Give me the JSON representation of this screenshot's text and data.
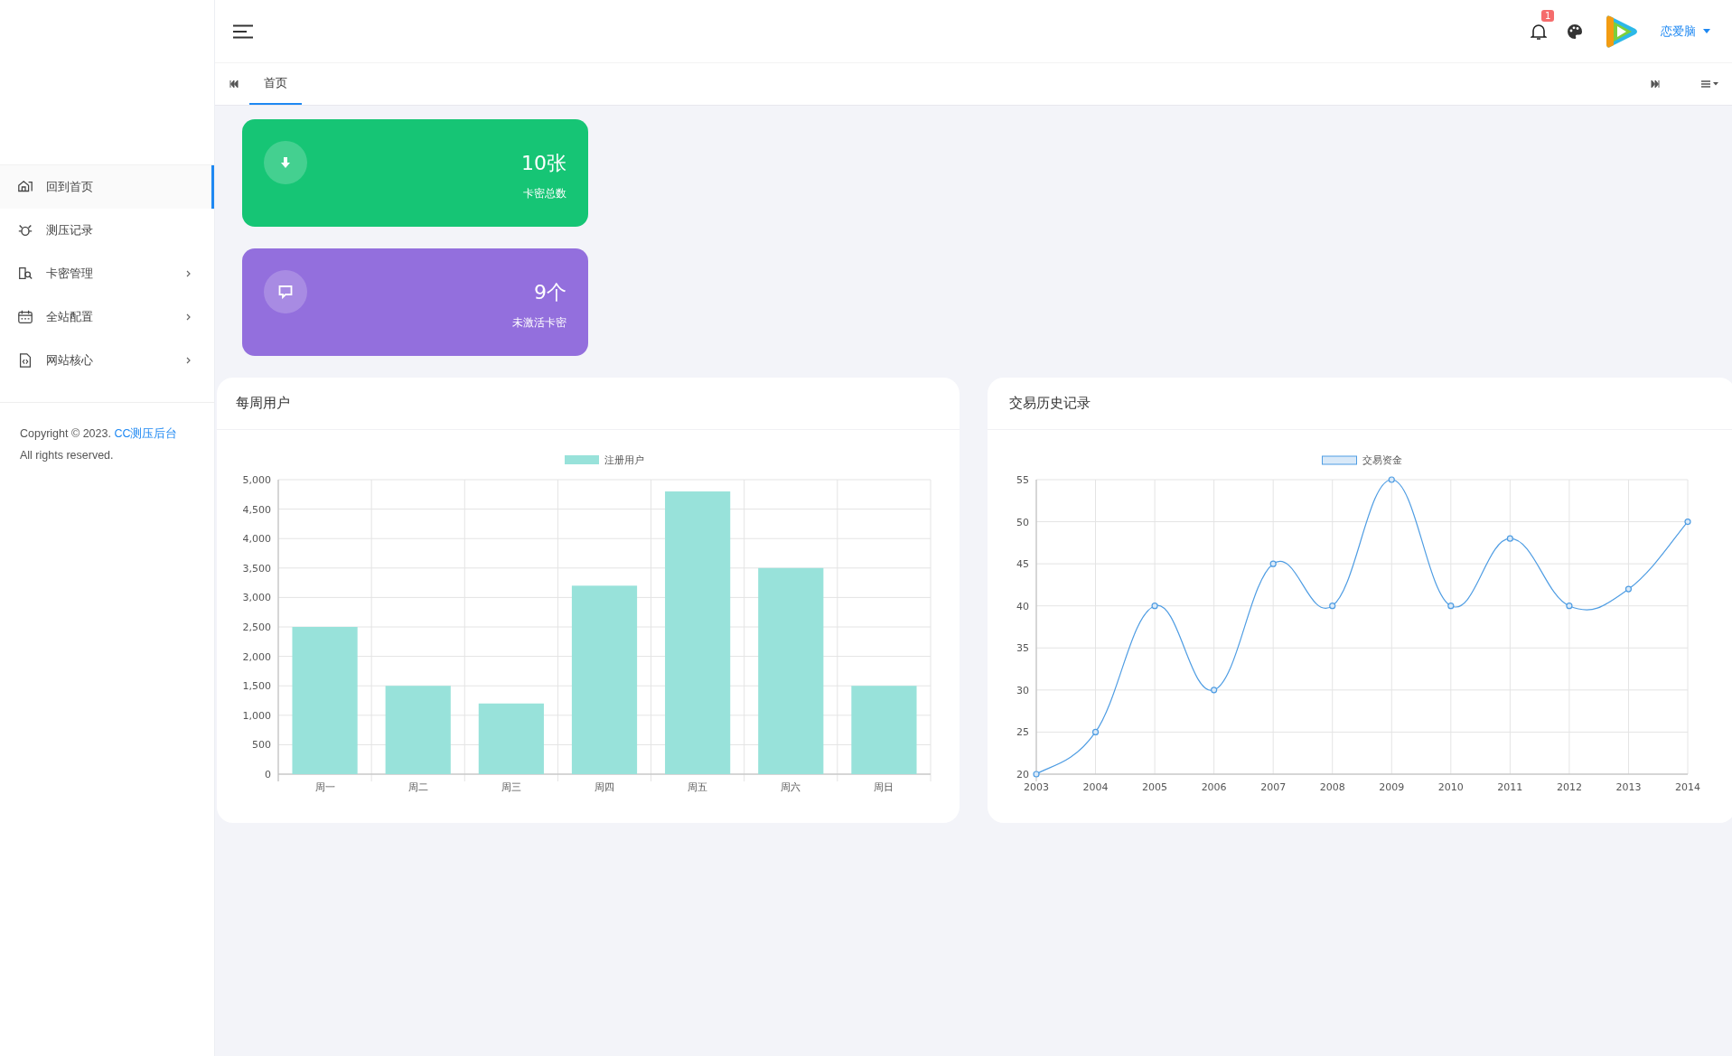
{
  "header": {
    "notification_count": "1",
    "user_name": "恋爱脑"
  },
  "tabs": [
    {
      "label": "首页",
      "selected": true
    }
  ],
  "sidebar": {
    "items": [
      {
        "label": "回到首页",
        "selected": true,
        "has_submenu": false
      },
      {
        "label": "测压记录",
        "selected": false,
        "has_submenu": false
      },
      {
        "label": "卡密管理",
        "selected": false,
        "has_submenu": true
      },
      {
        "label": "全站配置",
        "selected": false,
        "has_submenu": true
      },
      {
        "label": "网站核心",
        "selected": false,
        "has_submenu": true
      }
    ],
    "footer": {
      "copyright": "Copyright © 2023.",
      "link": "CC测压后台",
      "rights": "All rights reserved."
    }
  },
  "stats": [
    {
      "value": "10张",
      "label": "卡密总数",
      "color": "#16c575"
    },
    {
      "value": "9个",
      "label": "未激活卡密",
      "color": "#936fdd"
    }
  ],
  "panels": [
    {
      "title": "每周用户",
      "chart_data": {
        "type": "bar",
        "categories": [
          "周一",
          "周二",
          "周三",
          "周四",
          "周五",
          "周六",
          "周日"
        ],
        "series": [
          {
            "name": "注册用户",
            "color": "#98e2da",
            "values": [
              2500,
              1500,
              1200,
              3200,
              4800,
              3500,
              1500
            ]
          }
        ],
        "ylim": [
          0,
          5000
        ],
        "grid": true,
        "yticks": [
          0,
          500,
          {
            "value": 1000,
            "label": "1,000"
          },
          {
            "value": 1500,
            "label": "1,500"
          },
          {
            "value": 2000,
            "label": "2,000"
          },
          {
            "value": 2500,
            "label": "2,500"
          },
          {
            "value": 3000,
            "label": "3,000"
          },
          {
            "value": 3500,
            "label": "3,500"
          },
          {
            "value": 4000,
            "label": "4,000"
          },
          {
            "value": 4500,
            "label": "4,500"
          },
          {
            "value": 5000,
            "label": "5,000"
          }
        ]
      }
    },
    {
      "title": "交易历史记录",
      "chart_data": {
        "type": "line",
        "categories": [
          "2003",
          "2004",
          "2005",
          "2006",
          "2007",
          "2008",
          "2009",
          "2010",
          "2011",
          "2012",
          "2013",
          "2014"
        ],
        "series": [
          {
            "name": "交易资金",
            "color": "#4f9de3",
            "marker": true,
            "values": [
              20,
              25,
              40,
              30,
              45,
              40,
              55,
              40,
              48,
              40,
              42,
              50
            ]
          }
        ],
        "ylim": [
          20,
          55
        ],
        "grid": true,
        "yticks": [
          20,
          25,
          30,
          35,
          40,
          45,
          50,
          55
        ]
      }
    }
  ]
}
